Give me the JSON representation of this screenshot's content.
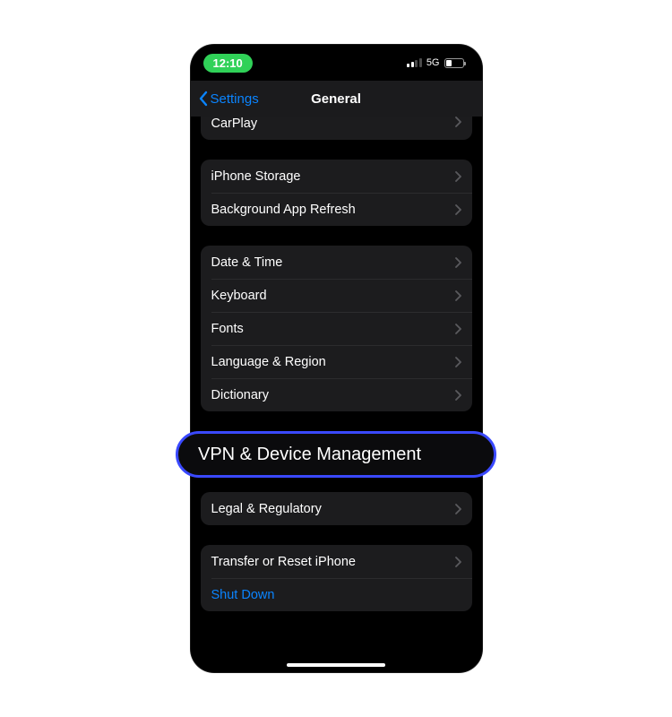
{
  "status": {
    "time": "12:10",
    "network": "5G"
  },
  "nav": {
    "back_label": "Settings",
    "title": "General"
  },
  "groups": {
    "g0": {
      "carplay": "CarPlay"
    },
    "g1": {
      "storage": "iPhone Storage",
      "refresh": "Background App Refresh"
    },
    "g2": {
      "datetime": "Date & Time",
      "keyboard": "Keyboard",
      "fonts": "Fonts",
      "language": "Language & Region",
      "dictionary": "Dictionary"
    },
    "g3": {
      "vpn": "VPN & Device Management"
    },
    "g4": {
      "legal": "Legal & Regulatory"
    },
    "g5": {
      "transfer": "Transfer or Reset iPhone",
      "shutdown": "Shut Down"
    }
  },
  "highlight": {
    "label": "VPN & Device Management"
  }
}
